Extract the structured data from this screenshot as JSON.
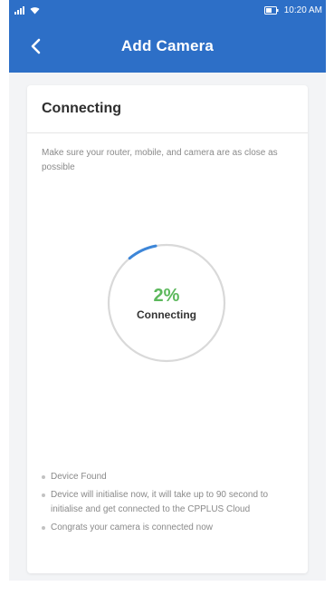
{
  "status_bar": {
    "time": "10:20 AM",
    "icons": [
      "signal-icon",
      "wifi-icon",
      "battery-icon"
    ]
  },
  "header": {
    "title": "Add Camera",
    "back_icon": "chevron-left-icon"
  },
  "card": {
    "title": "Connecting",
    "instruction": "Make sure your router, mobile, and camera are as close as possible",
    "progress": {
      "percent_text": "2%",
      "value": 0.02,
      "label": "Connecting"
    },
    "steps": [
      "Device Found",
      "Device will initialise now, it will take up to 90 second to initialise and get connected to the CPPLUS Cloud",
      "Congrats your camera is connected now"
    ]
  },
  "colors": {
    "primary": "#2d6fc7",
    "progress_text": "#5cb85c",
    "progress_arc": "#3d86d8",
    "ring": "#d9d9d9"
  }
}
